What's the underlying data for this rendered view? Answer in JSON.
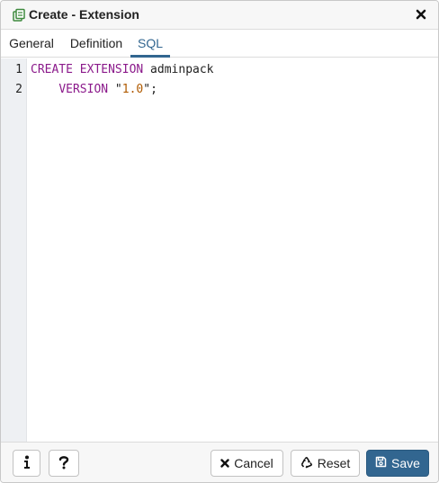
{
  "dialog": {
    "title": "Create - Extension",
    "title_icon": "extension-icon",
    "close_icon": "close-icon"
  },
  "tabs": [
    {
      "label": "General",
      "active": false
    },
    {
      "label": "Definition",
      "active": false
    },
    {
      "label": "SQL",
      "active": true
    }
  ],
  "editor": {
    "lines": [
      {
        "number": "1",
        "keyword": "CREATE EXTENSION",
        "rest": " adminpack"
      },
      {
        "number": "2",
        "indent": "    ",
        "keyword": "VERSION",
        "str_open": " \"",
        "num": "1.0",
        "str_close": "\";"
      }
    ]
  },
  "footer": {
    "info_icon": "info-icon",
    "help_icon": "help-icon",
    "cancel_label": "Cancel",
    "reset_label": "Reset",
    "save_label": "Save"
  },
  "colors": {
    "accent": "#326690",
    "keyword": "#8b1a8b",
    "number": "#b05a00"
  }
}
